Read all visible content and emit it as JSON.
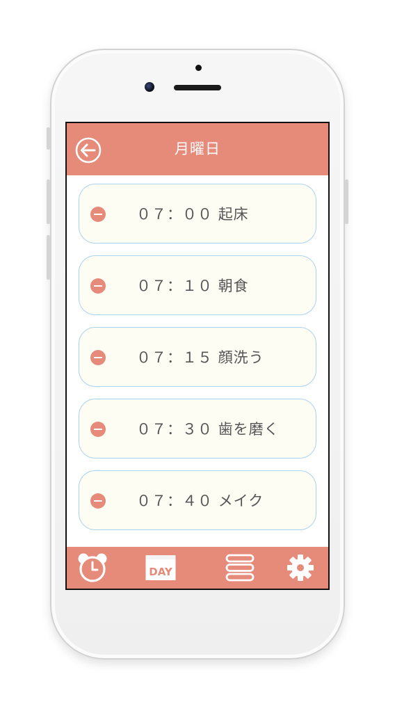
{
  "header": {
    "title": "月曜日",
    "back_icon": "back-arrow-icon"
  },
  "schedule": {
    "items": [
      {
        "time": "０７：００",
        "label": "起床"
      },
      {
        "time": "０７：１０",
        "label": "朝食"
      },
      {
        "time": "０７：１５",
        "label": "顔洗う"
      },
      {
        "time": "０７：３０",
        "label": "歯を磨く"
      },
      {
        "time": "０７：４０",
        "label": "メイク"
      }
    ],
    "remove_icon": "minus-circle-icon"
  },
  "tabbar": {
    "tabs": [
      {
        "name": "alarm",
        "icon": "alarm-clock-icon"
      },
      {
        "name": "day",
        "icon": "day-calendar-icon",
        "text": "DAY"
      },
      {
        "name": "list",
        "icon": "list-icon"
      },
      {
        "name": "settings",
        "icon": "gear-icon"
      }
    ]
  },
  "colors": {
    "accent": "#e68a7a",
    "card_background": "#fefdf4",
    "card_border": "#a9d3ee",
    "text": "#555555"
  }
}
